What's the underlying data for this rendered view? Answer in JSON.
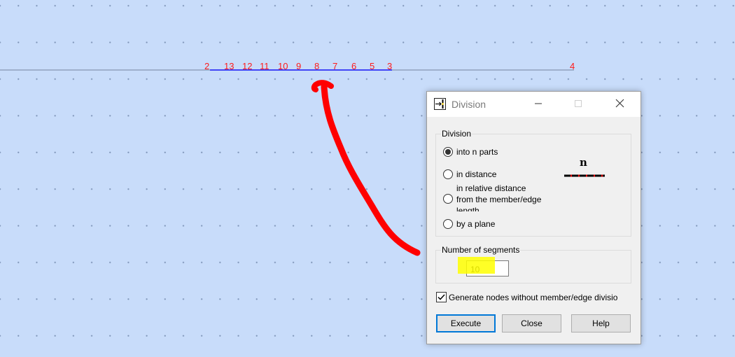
{
  "canvas": {
    "node_labels": [
      "2",
      "13",
      "12",
      "11",
      "10",
      "9",
      "8",
      "7",
      "6",
      "5",
      "3",
      "4"
    ]
  },
  "dialog": {
    "title": "Division",
    "controls": {
      "minimize_icon": "minimize-icon",
      "maximize_icon": "maximize-icon",
      "close_icon": "close-icon"
    },
    "division_group": {
      "legend": "Division",
      "options": [
        {
          "label": "into n parts",
          "checked": true
        },
        {
          "label": "in distance",
          "checked": false
        },
        {
          "label_line1": "in relative distance",
          "label_line2": "from the member/edge",
          "label_line3": "length",
          "checked": false
        },
        {
          "label": "by a plane",
          "checked": false
        }
      ],
      "preview_symbol": "n"
    },
    "segments_group": {
      "legend": "Number of segments",
      "value": "10"
    },
    "generate_nodes": {
      "label": "Generate nodes without member/edge divisio",
      "checked": true
    },
    "buttons": {
      "execute": "Execute",
      "close": "Close",
      "help": "Help"
    }
  },
  "colors": {
    "canvas_bg": "#c8dcfa",
    "node_label": "#ff1a1a",
    "member_line": "#1f1fff",
    "annotation_arrow": "#ff0000",
    "highlight": "#ffff00",
    "default_button_border": "#0078d7"
  }
}
